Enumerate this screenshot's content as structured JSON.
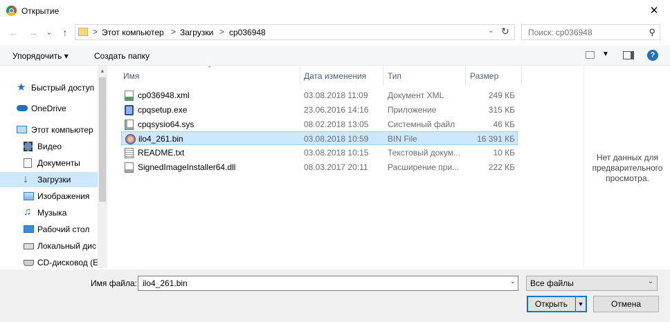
{
  "window": {
    "title": "Открытие",
    "close_glyph": "✕"
  },
  "nav": {
    "back_glyph": "←",
    "forward_glyph": "→",
    "recent_glyph": "⌄",
    "up_glyph": "↑",
    "breadcrumbs": [
      "Этот компьютер",
      "Загрузки",
      "cp036948"
    ],
    "separator": ">",
    "search_placeholder": "Поиск: cp036948"
  },
  "toolbar": {
    "organize_label": "Упорядочить ▾",
    "new_folder_label": "Создать папку"
  },
  "sidebar": {
    "items": [
      {
        "label": "Быстрый доступ",
        "icon": "star-icon"
      },
      {
        "label": "OneDrive",
        "icon": "cloud-icon"
      },
      {
        "label": "Этот компьютер",
        "icon": "computer-icon"
      },
      {
        "label": "Видео",
        "icon": "video-icon"
      },
      {
        "label": "Документы",
        "icon": "documents-icon"
      },
      {
        "label": "Загрузки",
        "icon": "download-icon"
      },
      {
        "label": "Изображения",
        "icon": "pictures-icon"
      },
      {
        "label": "Музыка",
        "icon": "music-icon"
      },
      {
        "label": "Рабочий стол",
        "icon": "desktop-icon"
      },
      {
        "label": "Локальный дис",
        "icon": "drive-icon"
      },
      {
        "label": "CD-дисковод (E",
        "icon": "cd-drive-icon"
      }
    ]
  },
  "file_list": {
    "columns": [
      "Имя",
      "Дата изменения",
      "Тип",
      "Размер"
    ],
    "rows": [
      {
        "name": "cp036948.xml",
        "date": "03.08.2018 11:09",
        "type": "Документ XML",
        "size": "249 КБ",
        "icon": "xml-file-icon"
      },
      {
        "name": "cpqsetup.exe",
        "date": "23.06.2016 14:16",
        "type": "Приложение",
        "size": "315 КБ",
        "icon": "exe-file-icon"
      },
      {
        "name": "cpqsysio64.sys",
        "date": "08.02.2018 13:05",
        "type": "Системный файл",
        "size": "46 КБ",
        "icon": "sys-file-icon"
      },
      {
        "name": "ilo4_261.bin",
        "date": "03.08.2018 10:59",
        "type": "BIN File",
        "size": "16 391 КБ",
        "icon": "bin-file-icon"
      },
      {
        "name": "README.txt",
        "date": "03.08.2018 10:15",
        "type": "Текстовый докум...",
        "size": "10 КБ",
        "icon": "txt-file-icon"
      },
      {
        "name": "SignedImageInstaller64.dll",
        "date": "08.03.2017 20:11",
        "type": "Расширение при...",
        "size": "222 КБ",
        "icon": "dll-file-icon"
      }
    ],
    "selected_index": 3
  },
  "preview": {
    "message": "Нет данных для предварительного просмотра."
  },
  "footer": {
    "filename_label": "Имя файла:",
    "filename_value": "ilo4_261.bin",
    "filetype_value": "Все файлы",
    "open_label": "Открыть",
    "cancel_label": "Отмена"
  },
  "colors": {
    "selection": "#cce8ff",
    "selection_border": "#99d1ff",
    "accent": "#0078d7"
  }
}
